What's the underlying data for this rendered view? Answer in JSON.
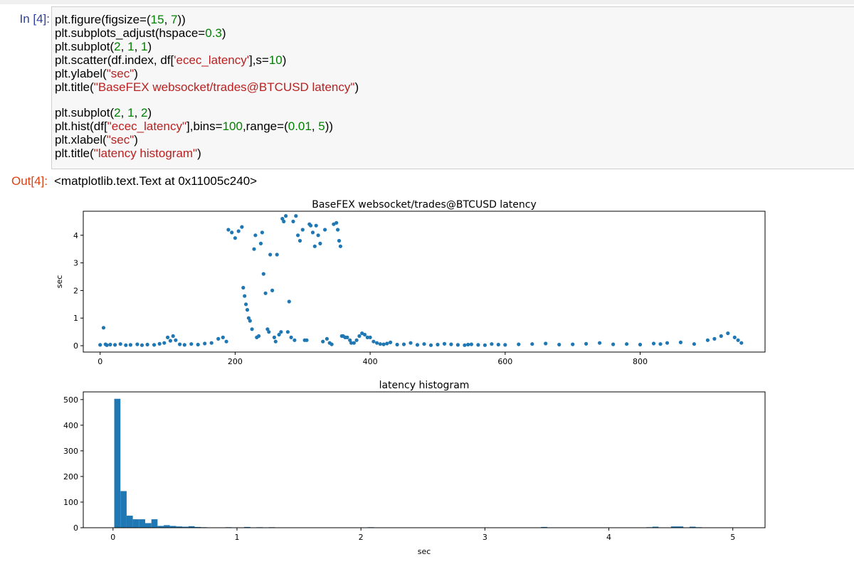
{
  "cell": {
    "in_prompt": "In [4]:",
    "out_prompt": "Out[4]:",
    "output_text": "<matplotlib.text.Text at 0x11005c240>",
    "code_lines": [
      [
        {
          "t": "plt.figure(figsize=("
        },
        {
          "t": "15",
          "c": "n"
        },
        {
          "t": ", "
        },
        {
          "t": "7",
          "c": "n"
        },
        {
          "t": "))"
        }
      ],
      [
        {
          "t": "plt.subplots_adjust(hspace="
        },
        {
          "t": "0.3",
          "c": "n"
        },
        {
          "t": ")"
        }
      ],
      [
        {
          "t": "plt.subplot("
        },
        {
          "t": "2",
          "c": "n"
        },
        {
          "t": ", "
        },
        {
          "t": "1",
          "c": "n"
        },
        {
          "t": ", "
        },
        {
          "t": "1",
          "c": "n"
        },
        {
          "t": ")"
        }
      ],
      [
        {
          "t": "plt.scatter(df.index, df["
        },
        {
          "t": "'ecec_latency'",
          "c": "s"
        },
        {
          "t": "],s="
        },
        {
          "t": "10",
          "c": "n"
        },
        {
          "t": ")"
        }
      ],
      [
        {
          "t": "plt.ylabel("
        },
        {
          "t": "\"sec\"",
          "c": "s"
        },
        {
          "t": ")"
        }
      ],
      [
        {
          "t": "plt.title("
        },
        {
          "t": "\"BaseFEX websocket/trades@BTCUSD latency\"",
          "c": "s"
        },
        {
          "t": ")"
        }
      ],
      [],
      [
        {
          "t": "plt.subplot("
        },
        {
          "t": "2",
          "c": "n"
        },
        {
          "t": ", "
        },
        {
          "t": "1",
          "c": "n"
        },
        {
          "t": ", "
        },
        {
          "t": "2",
          "c": "n"
        },
        {
          "t": ")"
        }
      ],
      [
        {
          "t": "plt.hist(df["
        },
        {
          "t": "\"ecec_latency\"",
          "c": "s"
        },
        {
          "t": "],bins="
        },
        {
          "t": "100",
          "c": "n"
        },
        {
          "t": ",range=("
        },
        {
          "t": "0.01",
          "c": "n"
        },
        {
          "t": ", "
        },
        {
          "t": "5",
          "c": "n"
        },
        {
          "t": "))"
        }
      ],
      [
        {
          "t": "plt.xlabel("
        },
        {
          "t": "\"sec\"",
          "c": "s"
        },
        {
          "t": ")"
        }
      ],
      [
        {
          "t": "plt.title("
        },
        {
          "t": "\"latency histogram\"",
          "c": "s"
        },
        {
          "t": ")"
        }
      ]
    ]
  },
  "chart_data": [
    {
      "type": "scatter",
      "title": "BaseFEX websocket/trades@BTCUSD latency",
      "xlabel": "",
      "ylabel": "sec",
      "xlim": [
        -25,
        985
      ],
      "ylim": [
        -0.23,
        4.87
      ],
      "xticks": [
        0,
        200,
        400,
        600,
        800
      ],
      "yticks": [
        0,
        1,
        2,
        3,
        4
      ],
      "grid": false,
      "color": "#1f77b4",
      "x": [
        0,
        5,
        8,
        10,
        15,
        22,
        30,
        38,
        45,
        55,
        62,
        70,
        80,
        88,
        95,
        100,
        104,
        108,
        112,
        118,
        125,
        135,
        145,
        155,
        165,
        175,
        182,
        187,
        190,
        195,
        200,
        205,
        210,
        212,
        214,
        216,
        218,
        220,
        222,
        225,
        228,
        230,
        232,
        235,
        238,
        240,
        242,
        245,
        248,
        250,
        252,
        255,
        258,
        260,
        262,
        265,
        268,
        270,
        272,
        275,
        278,
        280,
        283,
        286,
        288,
        290,
        293,
        296,
        300,
        303,
        306,
        310,
        312,
        315,
        318,
        320,
        323,
        326,
        330,
        333,
        336,
        340,
        343,
        346,
        350,
        352,
        354,
        356,
        358,
        360,
        363,
        366,
        370,
        372,
        376,
        380,
        384,
        388,
        392,
        396,
        400,
        405,
        410,
        415,
        420,
        425,
        430,
        440,
        450,
        460,
        470,
        480,
        490,
        500,
        510,
        520,
        530,
        540,
        545,
        550,
        560,
        570,
        580,
        590,
        600,
        620,
        640,
        660,
        680,
        700,
        720,
        740,
        760,
        780,
        800,
        820,
        830,
        840,
        860,
        880,
        900,
        910,
        920,
        930,
        940,
        945,
        950
      ],
      "y": [
        0.03,
        0.65,
        0.05,
        0.02,
        0.04,
        0.03,
        0.06,
        0.02,
        0.03,
        0.05,
        0.02,
        0.04,
        0.03,
        0.07,
        0.1,
        0.3,
        0.18,
        0.35,
        0.2,
        0.05,
        0.03,
        0.06,
        0.04,
        0.08,
        0.1,
        0.25,
        0.3,
        0.15,
        4.2,
        4.1,
        3.9,
        4.15,
        4.3,
        2.1,
        1.8,
        1.5,
        1.3,
        1.0,
        0.9,
        0.6,
        3.5,
        4.0,
        0.3,
        0.35,
        3.7,
        4.1,
        2.6,
        1.9,
        0.6,
        0.5,
        3.3,
        2.0,
        0.3,
        0.15,
        3.3,
        0.4,
        0.5,
        4.6,
        4.5,
        4.7,
        0.5,
        1.6,
        0.3,
        4.5,
        0.2,
        4.7,
        4.0,
        3.8,
        4.2,
        0.2,
        0.2,
        4.4,
        4.35,
        4.1,
        3.6,
        4.35,
        4.0,
        3.7,
        0.15,
        4.2,
        0.25,
        0.1,
        0.05,
        4.4,
        4.45,
        4.2,
        3.8,
        3.6,
        0.35,
        0.35,
        0.3,
        0.3,
        0.2,
        0.1,
        0.1,
        0.2,
        0.35,
        0.45,
        0.4,
        0.3,
        0.3,
        0.15,
        0.1,
        0.06,
        0.05,
        0.08,
        0.12,
        0.04,
        0.05,
        0.1,
        0.03,
        0.06,
        0.02,
        0.04,
        0.07,
        0.05,
        0.03,
        0.02,
        0.04,
        0.05,
        0.03,
        0.02,
        0.06,
        0.04,
        0.03,
        0.05,
        0.06,
        0.08,
        0.04,
        0.05,
        0.07,
        0.1,
        0.05,
        0.06,
        0.04,
        0.08,
        0.06,
        0.1,
        0.12,
        0.06,
        0.2,
        0.25,
        0.35,
        0.45,
        0.3,
        0.2,
        0.1,
        0.55,
        0.05
      ]
    },
    {
      "type": "bar",
      "title": "latency histogram",
      "xlabel": "sec",
      "ylabel": "",
      "xlim": [
        -0.24,
        5.26
      ],
      "ylim": [
        0,
        530
      ],
      "xticks": [
        0,
        1,
        2,
        3,
        4,
        5
      ],
      "yticks": [
        0,
        100,
        200,
        300,
        400,
        500
      ],
      "grid": false,
      "color": "#1f77b4",
      "bin_edges": [
        0.01,
        5
      ],
      "bins": 100,
      "counts": [
        503,
        143,
        47,
        33,
        33,
        18,
        33,
        7,
        10,
        7,
        5,
        4,
        6,
        3,
        2,
        1,
        1,
        1,
        2,
        0,
        1,
        3,
        1,
        2,
        0,
        2,
        1,
        0,
        0,
        1,
        0,
        0,
        1,
        0,
        0,
        0,
        1,
        0,
        1,
        0,
        0,
        2,
        0,
        0,
        0,
        1,
        0,
        0,
        0,
        0,
        0,
        0,
        0,
        0,
        0,
        0,
        0,
        0,
        0,
        0,
        0,
        0,
        0,
        0,
        0,
        0,
        0,
        0,
        0,
        3,
        0,
        1,
        0,
        1,
        0,
        0,
        0,
        0,
        0,
        0,
        0,
        0,
        0,
        0,
        0,
        0,
        2,
        4,
        1,
        0,
        5,
        5,
        0,
        4,
        2,
        1,
        0,
        0,
        0,
        0
      ]
    }
  ]
}
